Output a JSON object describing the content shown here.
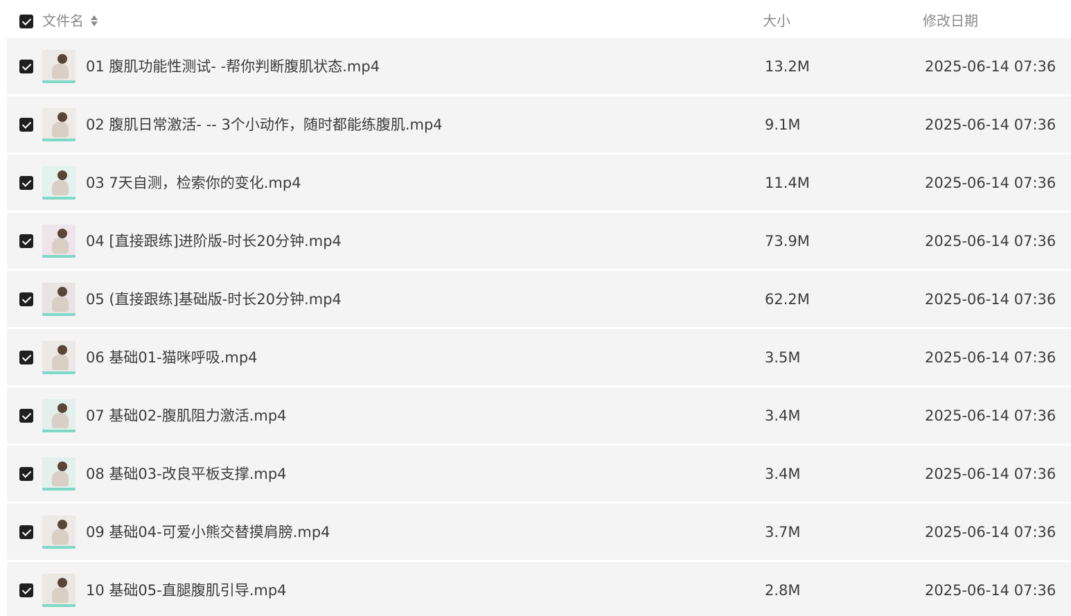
{
  "header": {
    "select_all_checked": true,
    "name_label": "文件名",
    "size_label": "大小",
    "date_label": "修改日期",
    "sort_icon": "sort-updown-icon"
  },
  "files": [
    {
      "name": "01 腹肌功能性测试- -帮你判断腹肌状态.mp4",
      "size": "13.2M",
      "date": "2025-06-14 07:36",
      "checked": true
    },
    {
      "name": "02 腹肌日常激活- -- 3个小动作，随时都能练腹肌.mp4",
      "size": "9.1M",
      "date": "2025-06-14 07:36",
      "checked": true
    },
    {
      "name": "03 7天自测，检索你的变化.mp4",
      "size": "11.4M",
      "date": "2025-06-14 07:36",
      "checked": true
    },
    {
      "name": "04 [直接跟练]进阶版-时长20分钟.mp4",
      "size": "73.9M",
      "date": "2025-06-14 07:36",
      "checked": true
    },
    {
      "name": "05 (直接跟练]基础版-时长20分钟.mp4",
      "size": "62.2M",
      "date": "2025-06-14 07:36",
      "checked": true
    },
    {
      "name": "06 基础01-猫咪呼吸.mp4",
      "size": "3.5M",
      "date": "2025-06-14 07:36",
      "checked": true
    },
    {
      "name": "07 基础02-腹肌阻力激活.mp4",
      "size": "3.4M",
      "date": "2025-06-14 07:36",
      "checked": true
    },
    {
      "name": "08 基础03-改良平板支撑.mp4",
      "size": "3.4M",
      "date": "2025-06-14 07:36",
      "checked": true
    },
    {
      "name": "09 基础04-可爱小熊交替摸肩膀.mp4",
      "size": "3.7M",
      "date": "2025-06-14 07:36",
      "checked": true
    },
    {
      "name": "10 基础05-直腿腹肌引导.mp4",
      "size": "2.8M",
      "date": "2025-06-14 07:36",
      "checked": true
    }
  ],
  "colors": {
    "row_background": "#f4f4f4",
    "checkbox": "#1f1f1f",
    "thumbnail_accent": "#7fd9c6"
  }
}
